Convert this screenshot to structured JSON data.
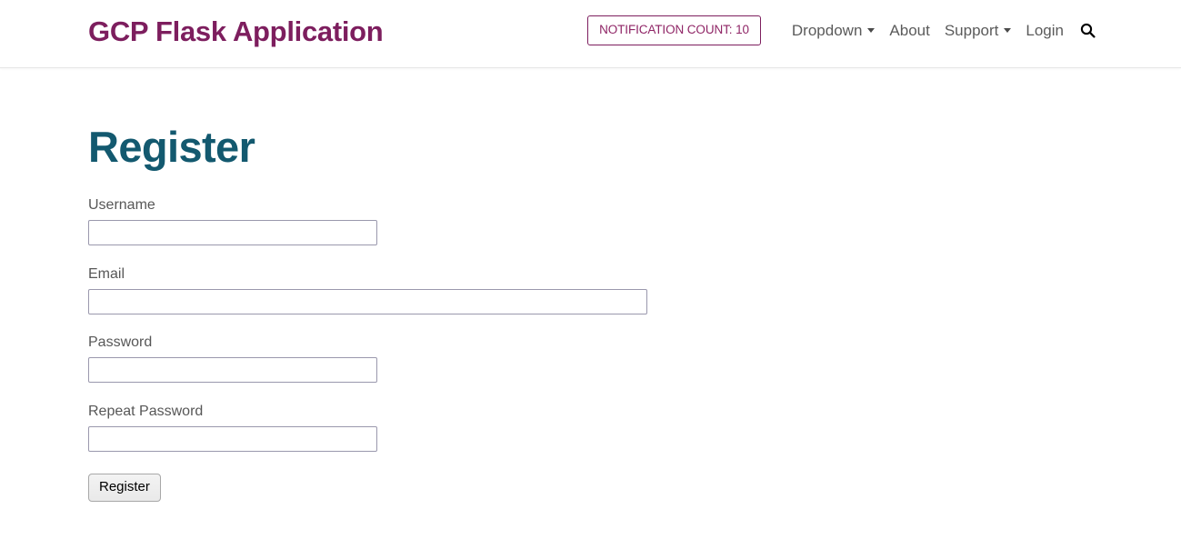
{
  "navbar": {
    "brand": "GCP Flask Application",
    "notification_badge": {
      "label": "NOTIFICATION COUNT: 10",
      "count": "10",
      "border_color": "#7d1e5e",
      "text_color": "#8f2566"
    },
    "links": [
      {
        "label": "Dropdown",
        "has_caret": true
      },
      {
        "label": "About",
        "has_caret": false
      },
      {
        "label": "Support",
        "has_caret": true
      },
      {
        "label": "Login",
        "has_caret": false
      }
    ],
    "search_icon": "search-icon",
    "brand_color": "#7d1e5e",
    "link_color": "#5b5b5b"
  },
  "main": {
    "title": "Register",
    "title_color": "#13596f",
    "form": {
      "fields": [
        {
          "label": "Username",
          "value": "",
          "placeholder": "",
          "type": "text",
          "width": "narrow"
        },
        {
          "label": "Email",
          "value": "",
          "placeholder": "",
          "type": "text",
          "width": "wide"
        },
        {
          "label": "Password",
          "value": "",
          "placeholder": "",
          "type": "password",
          "width": "narrow"
        },
        {
          "label": "Repeat Password",
          "value": "",
          "placeholder": "",
          "type": "password",
          "width": "narrow"
        }
      ],
      "submit_label": "Register"
    }
  }
}
